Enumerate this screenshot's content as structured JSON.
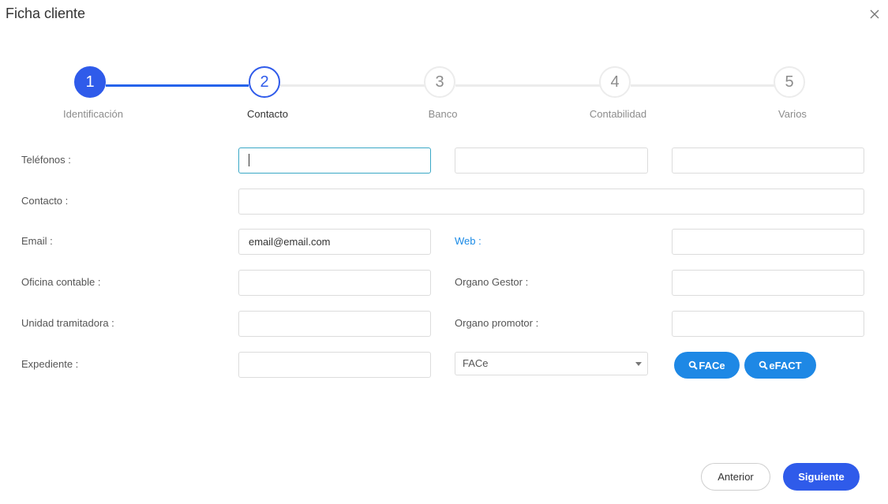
{
  "dialog": {
    "title": "Ficha cliente",
    "close_icon": "close-icon"
  },
  "stepper": {
    "current_step": 2,
    "steps": [
      {
        "number": "1",
        "label": "Identificación",
        "state": "done"
      },
      {
        "number": "2",
        "label": "Contacto",
        "state": "current"
      },
      {
        "number": "3",
        "label": "Banco",
        "state": "pending"
      },
      {
        "number": "4",
        "label": "Contabilidad",
        "state": "pending"
      },
      {
        "number": "5",
        "label": "Varios",
        "state": "pending"
      }
    ]
  },
  "form": {
    "telefonos_label": "Teléfonos :",
    "telefono1_value": "",
    "telefono2_value": "",
    "telefono3_value": "",
    "contacto_label": "Contacto :",
    "contacto_value": "",
    "email_label": "Email :",
    "email_value": "email@email.com",
    "web_label": "Web :",
    "web_value": "",
    "oficina_label": "Oficina contable :",
    "oficina_value": "",
    "organo_gestor_label": "Organo Gestor :",
    "organo_gestor_value": "",
    "unidad_label": "Unidad tramitadora :",
    "unidad_value": "",
    "organo_promotor_label": "Organo promotor :",
    "organo_promotor_value": "",
    "expediente_label": "Expediente :",
    "expediente_value": "",
    "platform_select_value": "FACe",
    "face_button": "FACe",
    "efact_button": "eFACT"
  },
  "footer": {
    "prev_label": "Anterior",
    "next_label": "Siguiente"
  },
  "colors": {
    "primary": "#2f5bea",
    "accent_button": "#1e88e5",
    "link": "#1a8ae6",
    "focus_border": "#3aa8c6"
  }
}
